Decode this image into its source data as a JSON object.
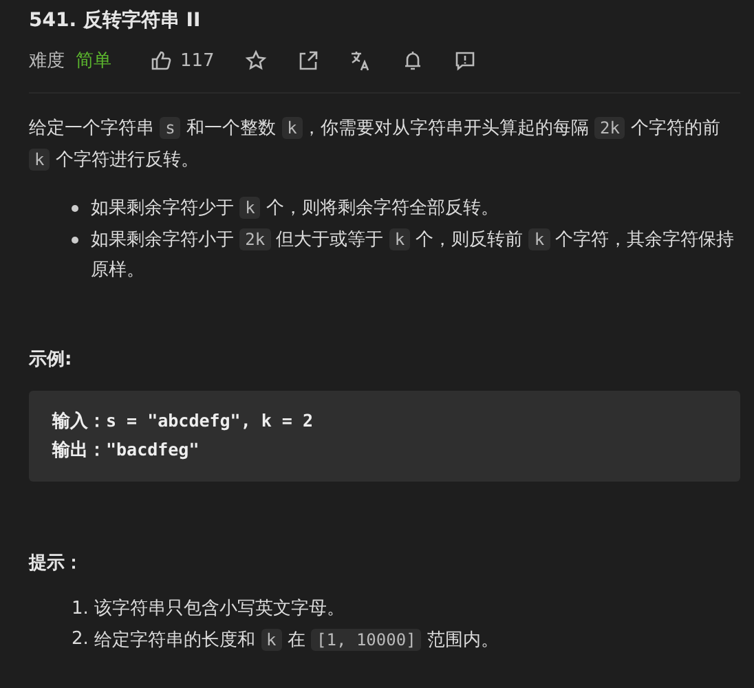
{
  "title": "541. 反转字符串 II",
  "meta": {
    "difficulty_label": "难度",
    "difficulty": "简单",
    "likes": "117"
  },
  "description": [
    {
      "kind": "text",
      "text": "给定一个字符串 "
    },
    {
      "kind": "code",
      "text": "s"
    },
    {
      "kind": "text",
      "text": " 和一个整数 "
    },
    {
      "kind": "code",
      "text": "k"
    },
    {
      "kind": "text",
      "text": "，你需要对从字符串开头算起的每隔 "
    },
    {
      "kind": "code",
      "text": "2k"
    },
    {
      "kind": "text",
      "text": " 个字符的前 "
    },
    {
      "kind": "code",
      "text": "k"
    },
    {
      "kind": "text",
      "text": " 个字符进行反转。"
    }
  ],
  "rules": [
    [
      {
        "kind": "text",
        "text": "如果剩余字符少于 "
      },
      {
        "kind": "code",
        "text": "k"
      },
      {
        "kind": "text",
        "text": " 个，则将剩余字符全部反转。"
      }
    ],
    [
      {
        "kind": "text",
        "text": "如果剩余字符小于 "
      },
      {
        "kind": "code",
        "text": "2k"
      },
      {
        "kind": "text",
        "text": " 但大于或等于 "
      },
      {
        "kind": "code",
        "text": "k"
      },
      {
        "kind": "text",
        "text": " 个，则反转前 "
      },
      {
        "kind": "code",
        "text": "k"
      },
      {
        "kind": "text",
        "text": " 个字符，其余字符保持原样。"
      }
    ]
  ],
  "example": {
    "heading": "示例:",
    "lines": [
      {
        "label": "输入：",
        "value": "s = \"abcdefg\", k = 2"
      },
      {
        "label": "输出：",
        "value": "\"bacdfeg\""
      }
    ]
  },
  "hints": {
    "heading": "提示：",
    "items": [
      {
        "number": "1.",
        "parts": [
          {
            "kind": "text",
            "text": "该字符串只包含小写英文字母。"
          }
        ]
      },
      {
        "number": "2.",
        "parts": [
          {
            "kind": "text",
            "text": "给定字符串的长度和 "
          },
          {
            "kind": "code",
            "text": "k"
          },
          {
            "kind": "text",
            "text": " 在 "
          },
          {
            "kind": "code",
            "text": "[1, 10000]"
          },
          {
            "kind": "text",
            "text": " 范围内。"
          }
        ]
      }
    ]
  }
}
